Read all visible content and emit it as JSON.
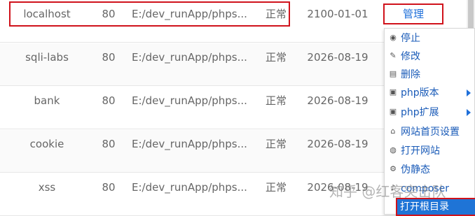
{
  "sites": [
    {
      "name": "localhost",
      "port": "80",
      "path": "E:/dev_runApp/phps...",
      "status": "正常",
      "expires": "2100-01-01"
    },
    {
      "name": "sqli-labs",
      "port": "80",
      "path": "E:/dev_runApp/phps...",
      "status": "正常",
      "expires": "2026-08-19"
    },
    {
      "name": "bank",
      "port": "80",
      "path": "E:/dev_runApp/phps...",
      "status": "正常",
      "expires": "2026-08-19"
    },
    {
      "name": "cookie",
      "port": "80",
      "path": "E:/dev_runApp/phps...",
      "status": "正常",
      "expires": "2026-08-19"
    },
    {
      "name": "xss",
      "port": "80",
      "path": "E:/dev_runApp/phps...",
      "status": "正常",
      "expires": "2026-08-19"
    }
  ],
  "manage_button": "管理",
  "menu": {
    "items": [
      {
        "label": "停止",
        "icon": "stop-icon"
      },
      {
        "label": "修改",
        "icon": "edit-icon"
      },
      {
        "label": "删除",
        "icon": "trash-icon"
      },
      {
        "label": "php版本",
        "icon": "php-version-icon",
        "submenu": true
      },
      {
        "label": "php扩展",
        "icon": "php-extension-icon",
        "submenu": true
      },
      {
        "label": "网站首页设置",
        "icon": "home-icon"
      },
      {
        "label": "打开网站",
        "icon": "globe-icon"
      },
      {
        "label": "伪静态",
        "icon": "rewrite-icon"
      },
      {
        "label": "composer",
        "icon": "composer-icon"
      },
      {
        "label": "打开根目录",
        "icon": ""
      }
    ]
  },
  "watermark": "知乎 @红客突击队",
  "colors": {
    "highlight_border": "#d0121b",
    "link_blue": "#1a5bb8",
    "selected_bg": "#1f74d6"
  }
}
